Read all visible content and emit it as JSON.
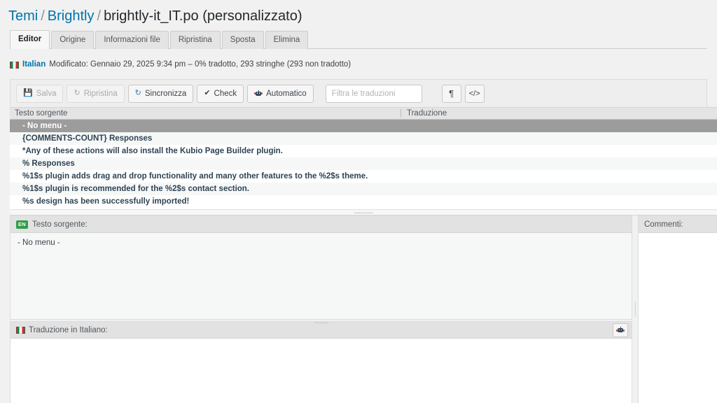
{
  "breadcrumb": {
    "root": "Temi",
    "theme": "Brightly",
    "file": "brightly-it_IT.po (personalizzato)",
    "separator": "/"
  },
  "tabs": [
    {
      "label": "Editor",
      "active": true
    },
    {
      "label": "Origine",
      "active": false
    },
    {
      "label": "Informazioni file",
      "active": false
    },
    {
      "label": "Ripristina",
      "active": false
    },
    {
      "label": "Sposta",
      "active": false
    },
    {
      "label": "Elimina",
      "active": false
    }
  ],
  "status": {
    "language": "Italian",
    "details": "Modificato: Gennaio 29, 2025 9:34 pm – 0% tradotto, 293 stringhe (293 non tradotto)",
    "link_color": "#0073aa"
  },
  "toolbar": {
    "save_label": "Salva",
    "revert_label": "Ripristina",
    "sync_label": "Sincronizza",
    "check_label": "Check",
    "auto_label": "Automatico",
    "filter_placeholder": "Filtra le traduzioni",
    "filter_value": "",
    "pilcrow_glyph": "¶",
    "code_glyph": "</>"
  },
  "list": {
    "columns": {
      "source": "Testo sorgente",
      "translation": "Traduzione"
    },
    "rows": [
      {
        "source": "- No menu -",
        "translation": "",
        "selected": true
      },
      {
        "source": "{COMMENTS-COUNT} Responses",
        "translation": "",
        "selected": false
      },
      {
        "source": "*Any of these actions will also install the Kubio Page Builder plugin.",
        "translation": "",
        "selected": false
      },
      {
        "source": "% Responses",
        "translation": "",
        "selected": false
      },
      {
        "source": "%1$s plugin adds drag and drop functionality and many other features to the %2$s theme.",
        "translation": "",
        "selected": false
      },
      {
        "source": "%1$s plugin is recommended for the %2$s contact section.",
        "translation": "",
        "selected": false
      },
      {
        "source": "%s design has been successfully imported!",
        "translation": "",
        "selected": false
      }
    ]
  },
  "source_panel": {
    "badge": "EN",
    "title": "Testo sorgente:",
    "content": "- No menu -"
  },
  "translation_panel": {
    "title": "Traduzione in Italiano:",
    "content": ""
  },
  "comments_panel": {
    "title": "Commenti:",
    "content": ""
  }
}
